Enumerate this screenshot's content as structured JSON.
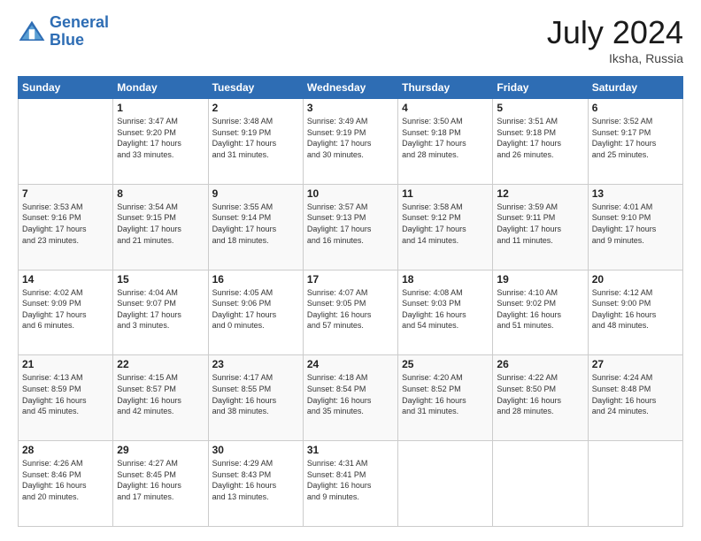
{
  "header": {
    "logo_line1": "General",
    "logo_line2": "Blue",
    "month_title": "July 2024",
    "location": "Iksha, Russia"
  },
  "weekdays": [
    "Sunday",
    "Monday",
    "Tuesday",
    "Wednesday",
    "Thursday",
    "Friday",
    "Saturday"
  ],
  "weeks": [
    [
      {
        "day": "",
        "info": ""
      },
      {
        "day": "1",
        "info": "Sunrise: 3:47 AM\nSunset: 9:20 PM\nDaylight: 17 hours\nand 33 minutes."
      },
      {
        "day": "2",
        "info": "Sunrise: 3:48 AM\nSunset: 9:19 PM\nDaylight: 17 hours\nand 31 minutes."
      },
      {
        "day": "3",
        "info": "Sunrise: 3:49 AM\nSunset: 9:19 PM\nDaylight: 17 hours\nand 30 minutes."
      },
      {
        "day": "4",
        "info": "Sunrise: 3:50 AM\nSunset: 9:18 PM\nDaylight: 17 hours\nand 28 minutes."
      },
      {
        "day": "5",
        "info": "Sunrise: 3:51 AM\nSunset: 9:18 PM\nDaylight: 17 hours\nand 26 minutes."
      },
      {
        "day": "6",
        "info": "Sunrise: 3:52 AM\nSunset: 9:17 PM\nDaylight: 17 hours\nand 25 minutes."
      }
    ],
    [
      {
        "day": "7",
        "info": "Sunrise: 3:53 AM\nSunset: 9:16 PM\nDaylight: 17 hours\nand 23 minutes."
      },
      {
        "day": "8",
        "info": "Sunrise: 3:54 AM\nSunset: 9:15 PM\nDaylight: 17 hours\nand 21 minutes."
      },
      {
        "day": "9",
        "info": "Sunrise: 3:55 AM\nSunset: 9:14 PM\nDaylight: 17 hours\nand 18 minutes."
      },
      {
        "day": "10",
        "info": "Sunrise: 3:57 AM\nSunset: 9:13 PM\nDaylight: 17 hours\nand 16 minutes."
      },
      {
        "day": "11",
        "info": "Sunrise: 3:58 AM\nSunset: 9:12 PM\nDaylight: 17 hours\nand 14 minutes."
      },
      {
        "day": "12",
        "info": "Sunrise: 3:59 AM\nSunset: 9:11 PM\nDaylight: 17 hours\nand 11 minutes."
      },
      {
        "day": "13",
        "info": "Sunrise: 4:01 AM\nSunset: 9:10 PM\nDaylight: 17 hours\nand 9 minutes."
      }
    ],
    [
      {
        "day": "14",
        "info": "Sunrise: 4:02 AM\nSunset: 9:09 PM\nDaylight: 17 hours\nand 6 minutes."
      },
      {
        "day": "15",
        "info": "Sunrise: 4:04 AM\nSunset: 9:07 PM\nDaylight: 17 hours\nand 3 minutes."
      },
      {
        "day": "16",
        "info": "Sunrise: 4:05 AM\nSunset: 9:06 PM\nDaylight: 17 hours\nand 0 minutes."
      },
      {
        "day": "17",
        "info": "Sunrise: 4:07 AM\nSunset: 9:05 PM\nDaylight: 16 hours\nand 57 minutes."
      },
      {
        "day": "18",
        "info": "Sunrise: 4:08 AM\nSunset: 9:03 PM\nDaylight: 16 hours\nand 54 minutes."
      },
      {
        "day": "19",
        "info": "Sunrise: 4:10 AM\nSunset: 9:02 PM\nDaylight: 16 hours\nand 51 minutes."
      },
      {
        "day": "20",
        "info": "Sunrise: 4:12 AM\nSunset: 9:00 PM\nDaylight: 16 hours\nand 48 minutes."
      }
    ],
    [
      {
        "day": "21",
        "info": "Sunrise: 4:13 AM\nSunset: 8:59 PM\nDaylight: 16 hours\nand 45 minutes."
      },
      {
        "day": "22",
        "info": "Sunrise: 4:15 AM\nSunset: 8:57 PM\nDaylight: 16 hours\nand 42 minutes."
      },
      {
        "day": "23",
        "info": "Sunrise: 4:17 AM\nSunset: 8:55 PM\nDaylight: 16 hours\nand 38 minutes."
      },
      {
        "day": "24",
        "info": "Sunrise: 4:18 AM\nSunset: 8:54 PM\nDaylight: 16 hours\nand 35 minutes."
      },
      {
        "day": "25",
        "info": "Sunrise: 4:20 AM\nSunset: 8:52 PM\nDaylight: 16 hours\nand 31 minutes."
      },
      {
        "day": "26",
        "info": "Sunrise: 4:22 AM\nSunset: 8:50 PM\nDaylight: 16 hours\nand 28 minutes."
      },
      {
        "day": "27",
        "info": "Sunrise: 4:24 AM\nSunset: 8:48 PM\nDaylight: 16 hours\nand 24 minutes."
      }
    ],
    [
      {
        "day": "28",
        "info": "Sunrise: 4:26 AM\nSunset: 8:46 PM\nDaylight: 16 hours\nand 20 minutes."
      },
      {
        "day": "29",
        "info": "Sunrise: 4:27 AM\nSunset: 8:45 PM\nDaylight: 16 hours\nand 17 minutes."
      },
      {
        "day": "30",
        "info": "Sunrise: 4:29 AM\nSunset: 8:43 PM\nDaylight: 16 hours\nand 13 minutes."
      },
      {
        "day": "31",
        "info": "Sunrise: 4:31 AM\nSunset: 8:41 PM\nDaylight: 16 hours\nand 9 minutes."
      },
      {
        "day": "",
        "info": ""
      },
      {
        "day": "",
        "info": ""
      },
      {
        "day": "",
        "info": ""
      }
    ]
  ]
}
